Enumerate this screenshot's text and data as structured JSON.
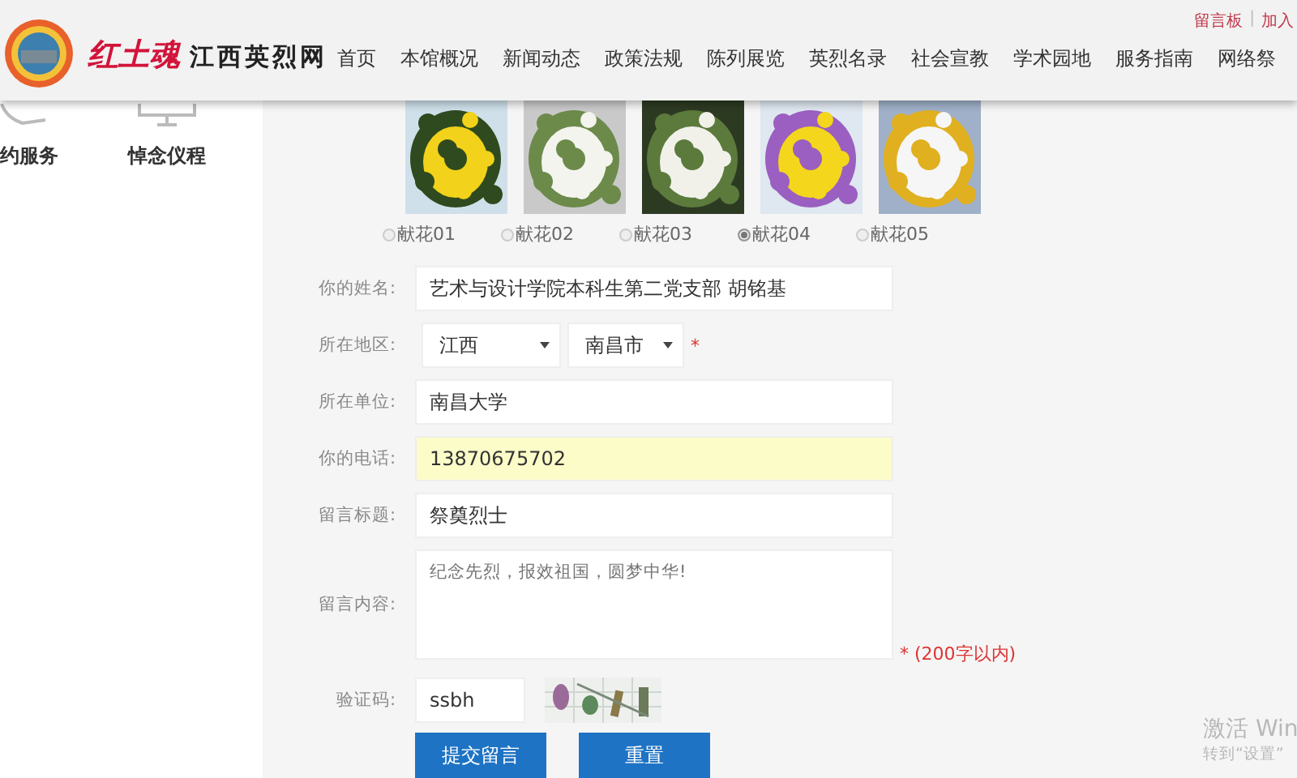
{
  "header": {
    "brand_red": "红土魂",
    "brand": "江西英烈网",
    "top_links": [
      "留言板",
      "加入"
    ],
    "separator": "|",
    "nav": [
      "首页",
      "本馆概况",
      "新闻动态",
      "政策法规",
      "陈列展览",
      "英烈名录",
      "社会宣教",
      "学术园地",
      "服务指南",
      "网络祭"
    ]
  },
  "sidebar": {
    "items": [
      {
        "label": "约服务",
        "kind": "phone"
      },
      {
        "label": "悼念仪程",
        "kind": "monitor"
      }
    ]
  },
  "flowers": [
    {
      "label": "献花01",
      "selected": false
    },
    {
      "label": "献花02",
      "selected": false
    },
    {
      "label": "献花03",
      "selected": false
    },
    {
      "label": "献花04",
      "selected": true
    },
    {
      "label": "献花05",
      "selected": false
    }
  ],
  "form": {
    "fields": [
      {
        "kind": "text",
        "label": "你的姓名:",
        "value": "艺术与设计学院本科生第二党支部 胡铭基",
        "highlighted": false
      },
      {
        "kind": "region",
        "label": "所在地区:",
        "province": "江西",
        "city": "南昌市",
        "required_mark": "*"
      },
      {
        "kind": "text",
        "label": "所在单位:",
        "value": "南昌大学",
        "highlighted": false
      },
      {
        "kind": "text",
        "label": "你的电话:",
        "value": "13870675702",
        "highlighted": true
      },
      {
        "kind": "text",
        "label": "留言标题:",
        "value": "祭奠烈士",
        "highlighted": false
      },
      {
        "kind": "textarea",
        "label": "留言内容:",
        "placeholder": "纪念先烈，报效祖国，圆梦中华!",
        "note": "* (200字以内)"
      },
      {
        "kind": "captcha",
        "label": "验证码:",
        "value": "ssbh"
      }
    ],
    "buttons": [
      "提交留言",
      "重置"
    ]
  },
  "os_notice": {
    "title": "激活 Win",
    "subtitle": "转到“设置”"
  }
}
